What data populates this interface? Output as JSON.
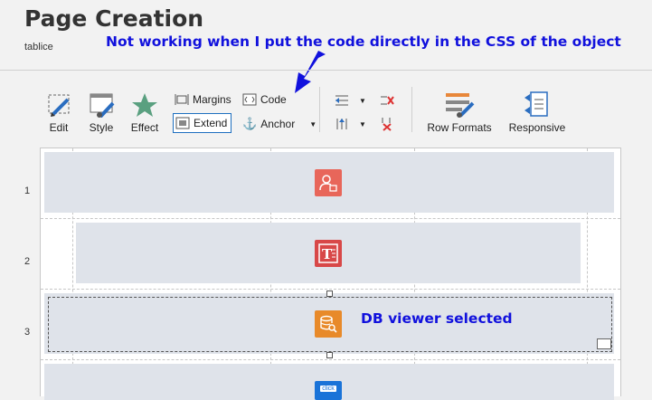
{
  "page": {
    "title": "Page Creation",
    "subtitle": "tablice"
  },
  "annotations": {
    "top_note": "Not working when I put the code directly in the CSS of the object",
    "selection_note": "DB viewer selected"
  },
  "toolbar": {
    "edit": "Edit",
    "style": "Style",
    "effect": "Effect",
    "margins": "Margins",
    "code": "Code",
    "extend": "Extend",
    "anchor": "Anchor",
    "row_formats": "Row Formats",
    "responsive": "Responsive"
  },
  "rows": [
    {
      "number": "1",
      "widget_icon": "user-lock-icon"
    },
    {
      "number": "2",
      "widget_icon": "text-icon"
    },
    {
      "number": "3",
      "widget_icon": "db-viewer-icon"
    },
    {
      "number": "",
      "widget_icon": "click-icon",
      "widget_label": "click"
    }
  ],
  "colors": {
    "annotation": "#1111dd",
    "row_block": "#dfe3ea",
    "user_widget": "#e8665a",
    "text_widget": "#d84848",
    "db_widget": "#e88a2a",
    "click_widget": "#1a73d8"
  }
}
